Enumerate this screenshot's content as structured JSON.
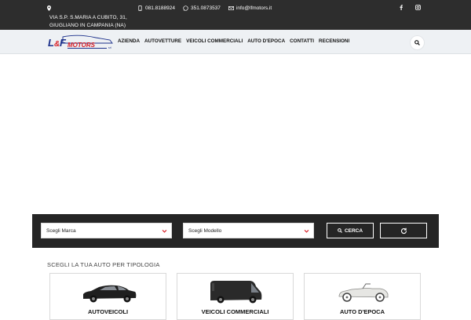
{
  "topbar": {
    "address_line1": "VIA S.P. S.MARIA A CUBITO, 31,",
    "address_line2": "GIUGLIANO IN CAMPANIA (NA)",
    "phone": "081.8188924",
    "whatsapp": "351.0873537",
    "email": "info@lfmotors.it",
    "social": [
      {
        "name": "facebook-icon",
        "glyph": "f"
      },
      {
        "name": "instagram-icon",
        "glyph": "◙"
      }
    ],
    "icons": {
      "address": "map-pin-icon",
      "phone": "phone-icon",
      "whatsapp": "whatsapp-icon",
      "email": "envelope-icon"
    }
  },
  "logo": {
    "text_main": "L&F",
    "text_sub": "MOTORS",
    "suffix": "srl",
    "colors": {
      "blue": "#1b2f8a",
      "red": "#d81f26"
    }
  },
  "nav": {
    "items": [
      "AZIENDA",
      "AUTOVETTURE",
      "VEICOLI COMMERCIALI",
      "AUTO D'EPOCA",
      "CONTATTI",
      "RECENSIONI"
    ],
    "search_icon": "search-icon"
  },
  "search": {
    "brand_placeholder": "Scegli Marca",
    "model_placeholder": "Scegli Modello",
    "submit_label": "CERCA",
    "reset_icon": "refresh-icon",
    "accent": "#d81f26"
  },
  "categories": {
    "title": "SCEGLI LA TUA AUTO PER TIPOLOGIA",
    "items": [
      {
        "label": "AUTOVEICOLI",
        "icon": "sedan-car-icon"
      },
      {
        "label": "VEICOLI COMMERCIALI",
        "icon": "van-icon"
      },
      {
        "label": "AUTO D'EPOCA",
        "icon": "vintage-car-icon"
      }
    ]
  }
}
